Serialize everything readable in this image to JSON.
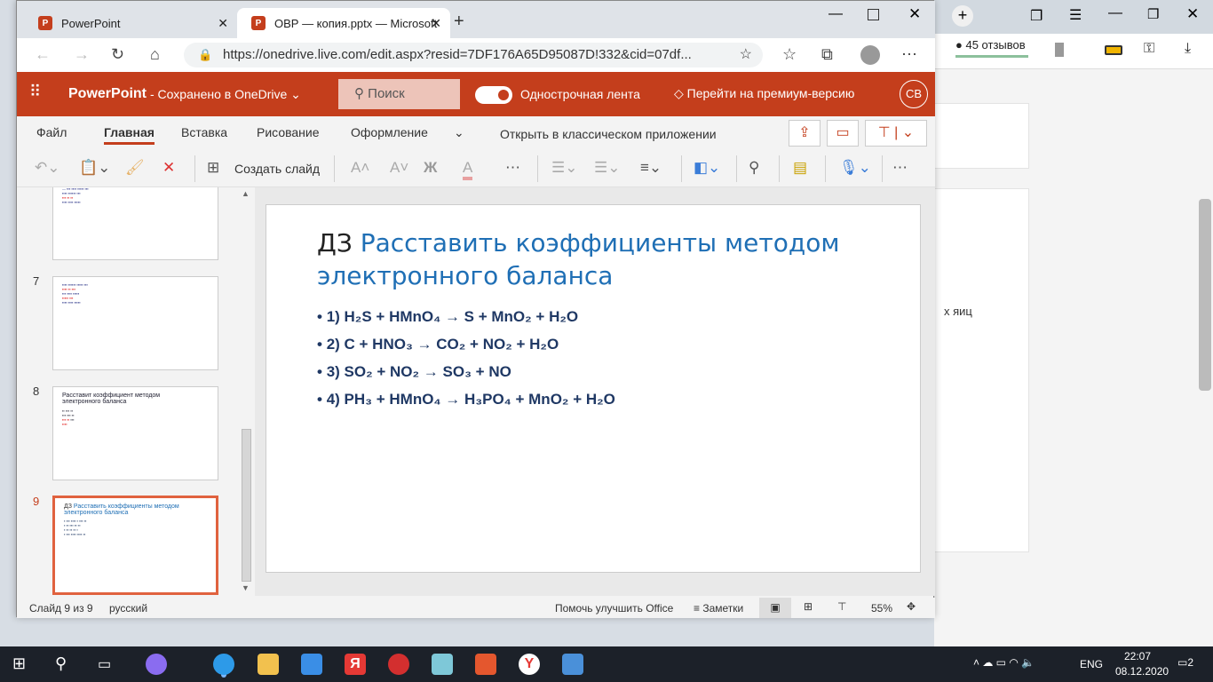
{
  "browser": {
    "tabs": [
      {
        "label": "PowerPoint"
      },
      {
        "label": "ОВР — копия.pptx — Microsoft"
      }
    ],
    "url": "https://onedrive.live.com/edit.aspx?resid=7DF176A65D95087D!332&cid=07df..."
  },
  "bg_browser": {
    "reviews": "45 отзывов",
    "partial_text": "х яиц"
  },
  "app": {
    "name": "PowerPoint",
    "save_status": "- Сохранено в OneDrive",
    "search": "Поиск",
    "toggle_label": "Однострочная лента",
    "premium": "Перейти на премиум-версию",
    "avatar": "СВ"
  },
  "menu": [
    "Файл",
    "Главная",
    "Вставка",
    "Рисование",
    "Оформление"
  ],
  "open_desktop": "Открыть в классическом приложении",
  "toolbar": {
    "new_slide": "Создать слайд"
  },
  "thumbnails": [
    {
      "num": "7"
    },
    {
      "num": "8",
      "title": "Расставит коэффициент методом электронного баланса"
    },
    {
      "num": "9",
      "title_prefix": "ДЗ",
      "title": "Расставить коэффициенты методом электронного баланса"
    }
  ],
  "slide": {
    "prefix": "ДЗ",
    "title": "Расставить коэффициенты методом электронного баланса",
    "items": [
      "1) H₂S + HMnO₄ → S + MnO₂ + H₂O",
      "2) C + HNO₃ → CO₂ + NO₂ + H₂O",
      "3) SO₂ + NO₂ → SO₃ + NO",
      "4) PH₃ + HMnO₄ → H₃PO₄ + MnO₂ + H₂O"
    ]
  },
  "status": {
    "slide": "Слайд 9 из 9",
    "lang": "русский",
    "help": "Помочь улучшить Office",
    "notes": "Заметки",
    "zoom": "55%"
  },
  "taskbar": {
    "lang": "ENG",
    "time": "22:07",
    "date": "08.12.2020",
    "notif": "2"
  },
  "colors": {
    "accent": "#c43e1c",
    "title_blue": "#1f6fb5",
    "body": "#1f3864"
  }
}
